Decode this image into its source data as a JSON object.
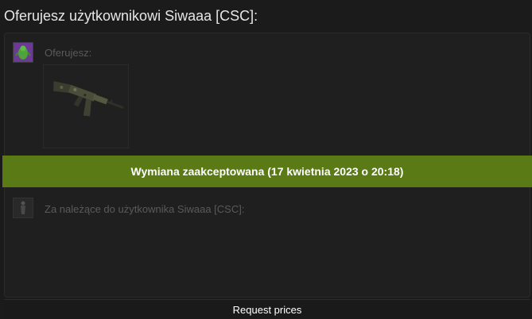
{
  "title": "Oferujesz użytkownikowi Siwaaa [CSC]:",
  "my_side": {
    "label": "Oferujesz:",
    "avatar_icon": "green-character-avatar-icon",
    "items": [
      {
        "icon": "ak47-rifle-icon"
      }
    ]
  },
  "status_banner": {
    "text": "Wymiana zaakceptowana (17 kwietnia 2023 o 20:18)",
    "color": "#5a7a16"
  },
  "their_side": {
    "label": "Za należące do użytkownika Siwaaa [CSC]:",
    "avatar_icon": "grey-figure-avatar-icon"
  },
  "request_button": {
    "label": "Request prices"
  }
}
